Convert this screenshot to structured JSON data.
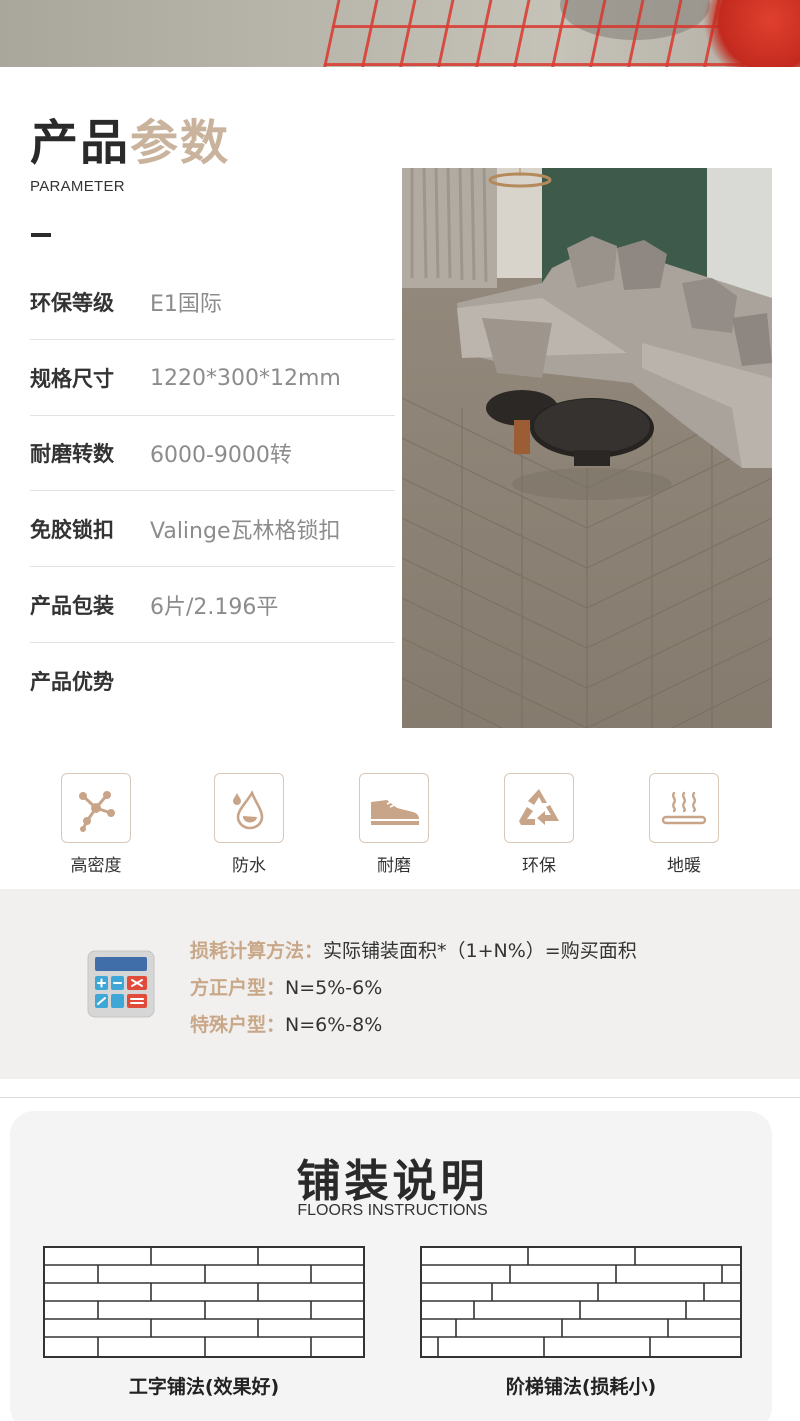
{
  "header": {
    "title_dark": "产品",
    "title_accent": "参数",
    "subtitle": "PARAMETER"
  },
  "params": [
    {
      "label": "环保等级",
      "value": "E1国际"
    },
    {
      "label": "规格尺寸",
      "value": "1220*300*12mm"
    },
    {
      "label": "耐磨转数",
      "value": "6000-9000转"
    },
    {
      "label": "免胶锁扣",
      "value": "Valinge瓦林格锁扣"
    },
    {
      "label": "产品包装",
      "value": "6片/2.196平"
    },
    {
      "label": "产品优势",
      "value": ""
    }
  ],
  "features": [
    {
      "label": "高密度",
      "icon": "molecule-icon"
    },
    {
      "label": "防水",
      "icon": "water-drop-icon"
    },
    {
      "label": "耐磨",
      "icon": "shoe-icon"
    },
    {
      "label": "环保",
      "icon": "recycle-icon"
    },
    {
      "label": "地暖",
      "icon": "floor-heating-icon"
    }
  ],
  "loss": {
    "method_key": "损耗计算方法：",
    "method_value": "实际铺装面积*（1+N%）=购买面积",
    "square_key": "方正户型：",
    "square_value": "N=5%-6%",
    "special_key": "特殊户型：",
    "special_value": "N=6%-8%"
  },
  "instructions": {
    "title": "铺装说明",
    "subtitle": "FLOORS INSTRUCTIONS",
    "patterns": [
      {
        "caption": "工字铺法(效果好)"
      },
      {
        "caption": "阶梯铺法(损耗小)"
      }
    ]
  },
  "colors": {
    "accent": "#c9b39c",
    "icon_border": "#d9c8b8",
    "loss_key": "#c9a889",
    "loss_bg": "#f1f0ee"
  }
}
